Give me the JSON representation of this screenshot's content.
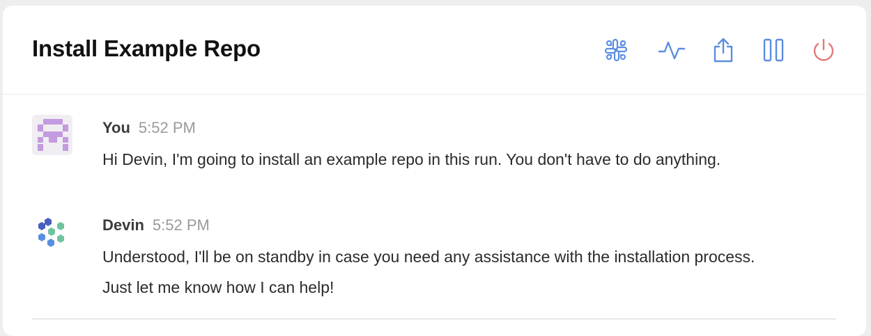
{
  "header": {
    "title": "Install Example Repo",
    "actions": [
      {
        "icon": "slack-icon",
        "color": "#5b8de0"
      },
      {
        "icon": "activity-icon",
        "color": "#5b8de0"
      },
      {
        "icon": "share-icon",
        "color": "#5b8de0"
      },
      {
        "icon": "pause-icon",
        "color": "#5b8de0"
      },
      {
        "icon": "power-icon",
        "color": "#e07a7a"
      }
    ]
  },
  "messages": [
    {
      "author": "You",
      "time": "5:52 PM",
      "text": "Hi Devin, I'm going to install an example repo in this run. You don't have to do anything.",
      "avatar": "user-pixel-avatar"
    },
    {
      "author": "Devin",
      "time": "5:52 PM",
      "text": "Understood, I'll be on standby in case you need any assistance with the installation process. Just let me know how I can help!",
      "avatar": "devin-logo-avatar"
    }
  ],
  "colors": {
    "accent": "#5b8de0",
    "danger": "#e07a7a",
    "user_avatar": "#c29be0"
  }
}
